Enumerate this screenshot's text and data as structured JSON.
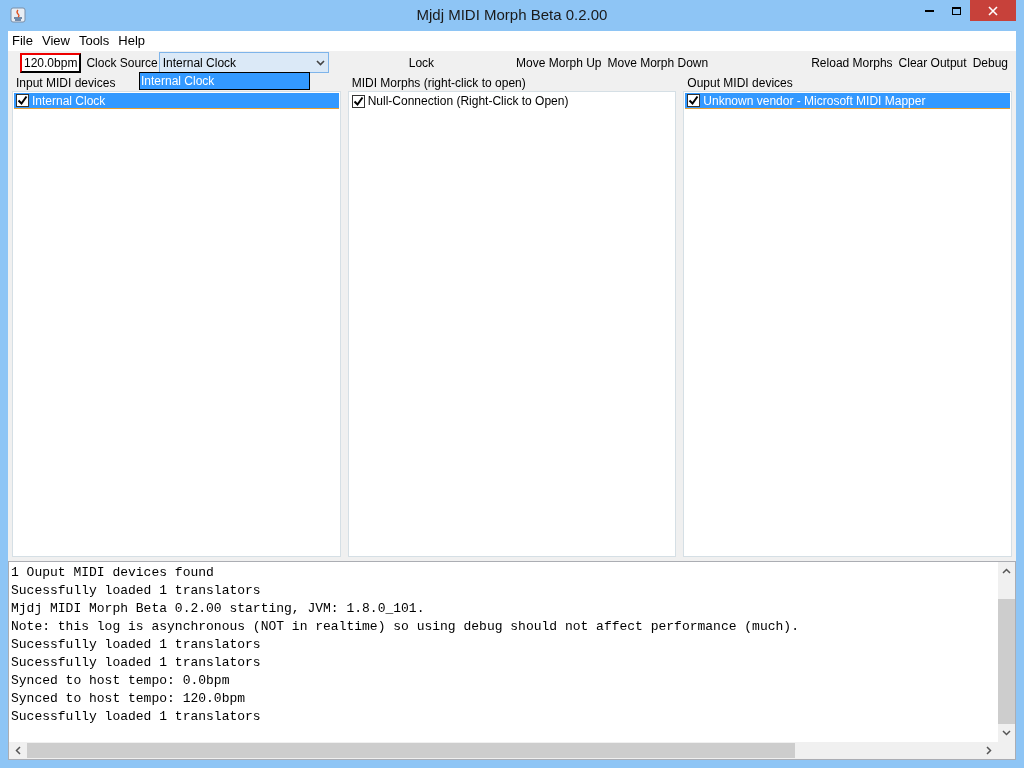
{
  "window": {
    "title": "Mjdj MIDI Morph Beta 0.2.00"
  },
  "menu": [
    "File",
    "View",
    "Tools",
    "Help"
  ],
  "toolbar": {
    "tempo": "120.0bpm",
    "clock_label": "Clock Source",
    "clock_value": "Internal Clock",
    "clock_open": true,
    "clock_options": [
      {
        "label": "Internal Clock",
        "selected": true
      }
    ],
    "buttons": [
      "Lock",
      "Move Morph Up",
      "Move Morph Down"
    ],
    "right_buttons": [
      "Reload Morphs",
      "Clear Output",
      "Debug"
    ]
  },
  "panels": [
    {
      "title": "Input MIDI devices",
      "items": [
        {
          "label": "Internal Clock",
          "checked": true,
          "selected": true
        }
      ]
    },
    {
      "title": "MIDI Morphs (right-click to open)",
      "items": [
        {
          "label": "Null-Connection (Right-Click to Open)",
          "checked": true,
          "selected": false
        }
      ]
    },
    {
      "title": "Ouput MIDI devices",
      "items": [
        {
          "label": "Unknown vendor - Microsoft MIDI Mapper",
          "checked": true,
          "selected": true
        }
      ]
    }
  ],
  "log": [
    "1 Ouput MIDI devices found",
    "Sucessfully loaded 1 translators",
    "Mjdj MIDI Morph Beta 0.2.00 starting, JVM: 1.8.0_101.",
    "Note: this log is asynchronous (NOT in realtime) so using debug should not affect performance (much).",
    "Sucessfully loaded 1 translators",
    "Sucessfully loaded 1 translators",
    "Synced to host tempo: 0.0bpm",
    "Synced to host tempo: 120.0bpm",
    "Sucessfully loaded 1 translators"
  ]
}
